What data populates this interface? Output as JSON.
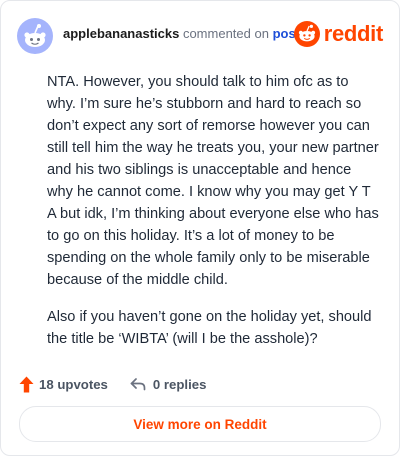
{
  "header": {
    "username": "applebananasticks",
    "action_text": "commented on",
    "post_link": "post",
    "brand": "reddit",
    "avatar_icon": "reddit-avatar-icon",
    "brand_icon": "reddit-logo-icon"
  },
  "comment": {
    "paragraphs": [
      "NTA. However, you should talk to him ofc as to why. I’m sure he’s stubborn and hard to reach so don’t expect any sort of remorse however you can still tell him the way he treats you, your new partner and his two siblings is unacceptable and hence why he cannot come. I know why you may get Y T A but idk, I’m thinking about everyone else who has to go on this holiday. It’s a lot of money to be spending on the whole family only to be miserable because of the middle child.",
      "Also if you haven’t gone on the holiday yet, should the title be ‘WIBTA’ (will I be the asshole)?"
    ]
  },
  "footer": {
    "upvotes": "18 upvotes",
    "replies": "0 replies",
    "upvote_icon": "upvote-arrow-icon",
    "reply_icon": "reply-arrow-icon"
  },
  "button": {
    "label": "View more on Reddit"
  },
  "colors": {
    "brand": "#ff4500",
    "link": "#1d4ed8",
    "avatar_bg": "#a5b4fc"
  }
}
